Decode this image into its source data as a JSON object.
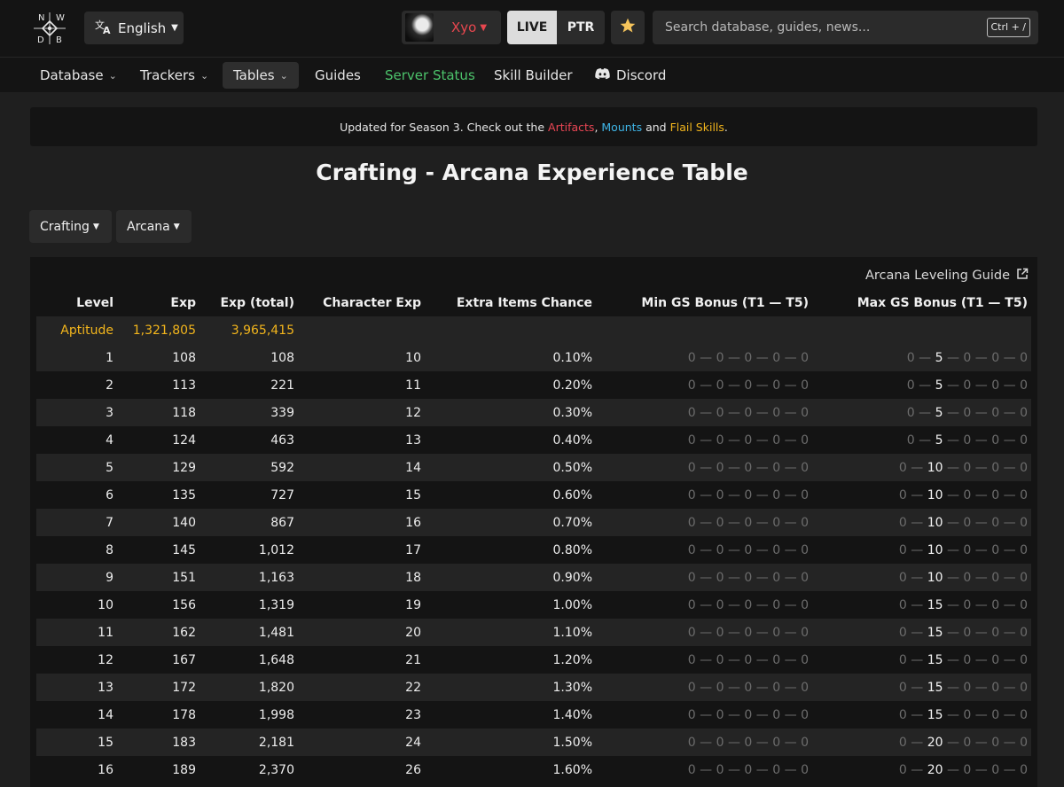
{
  "header": {
    "logo_letters": [
      "N",
      "W",
      "D",
      "B"
    ],
    "language": "English",
    "username": "Xyo",
    "env_live": "LIVE",
    "env_ptr": "PTR",
    "search_placeholder": "Search database, guides, news...",
    "search_shortcut": "Ctrl + /",
    "colors": {
      "accent_user": "#e8474f",
      "favorite_star": "#f5c45b"
    }
  },
  "nav": {
    "items": [
      {
        "label": "Database"
      },
      {
        "label": "Trackers"
      },
      {
        "label": "Tables"
      },
      {
        "label": "Guides"
      },
      {
        "label": "Server Status"
      },
      {
        "label": "Skill Builder"
      },
      {
        "label": "Discord"
      }
    ]
  },
  "banner": {
    "prefix": "Updated for Season 3. Check out the ",
    "link1": "Artifacts",
    "sep1": ", ",
    "link2": "Mounts",
    "sep2": " and ",
    "link3": "Flail Skills",
    "suffix": "."
  },
  "page": {
    "title": "Crafting - Arcana Experience Table",
    "filter_category": "Crafting",
    "filter_skill": "Arcana",
    "guide_link": "Arcana Leveling Guide"
  },
  "table": {
    "headers": [
      "Level",
      "Exp",
      "Exp (total)",
      "Character Exp",
      "Extra Items Chance",
      "Min GS Bonus (T1 — T5)",
      "Max GS Bonus (T1 — T5)"
    ],
    "aptitude": {
      "label": "Aptitude",
      "exp": "1,321,805",
      "exp_total": "3,965,415"
    },
    "rows": [
      {
        "level": "1",
        "exp": "108",
        "total": "108",
        "char_exp": "10",
        "chance": "0.10%",
        "min_gs": [
          "0",
          "0",
          "0",
          "0",
          "0"
        ],
        "max_gs": [
          "0",
          "5",
          "0",
          "0",
          "0"
        ]
      },
      {
        "level": "2",
        "exp": "113",
        "total": "221",
        "char_exp": "11",
        "chance": "0.20%",
        "min_gs": [
          "0",
          "0",
          "0",
          "0",
          "0"
        ],
        "max_gs": [
          "0",
          "5",
          "0",
          "0",
          "0"
        ]
      },
      {
        "level": "3",
        "exp": "118",
        "total": "339",
        "char_exp": "12",
        "chance": "0.30%",
        "min_gs": [
          "0",
          "0",
          "0",
          "0",
          "0"
        ],
        "max_gs": [
          "0",
          "5",
          "0",
          "0",
          "0"
        ]
      },
      {
        "level": "4",
        "exp": "124",
        "total": "463",
        "char_exp": "13",
        "chance": "0.40%",
        "min_gs": [
          "0",
          "0",
          "0",
          "0",
          "0"
        ],
        "max_gs": [
          "0",
          "5",
          "0",
          "0",
          "0"
        ]
      },
      {
        "level": "5",
        "exp": "129",
        "total": "592",
        "char_exp": "14",
        "chance": "0.50%",
        "min_gs": [
          "0",
          "0",
          "0",
          "0",
          "0"
        ],
        "max_gs": [
          "0",
          "10",
          "0",
          "0",
          "0"
        ]
      },
      {
        "level": "6",
        "exp": "135",
        "total": "727",
        "char_exp": "15",
        "chance": "0.60%",
        "min_gs": [
          "0",
          "0",
          "0",
          "0",
          "0"
        ],
        "max_gs": [
          "0",
          "10",
          "0",
          "0",
          "0"
        ]
      },
      {
        "level": "7",
        "exp": "140",
        "total": "867",
        "char_exp": "16",
        "chance": "0.70%",
        "min_gs": [
          "0",
          "0",
          "0",
          "0",
          "0"
        ],
        "max_gs": [
          "0",
          "10",
          "0",
          "0",
          "0"
        ]
      },
      {
        "level": "8",
        "exp": "145",
        "total": "1,012",
        "char_exp": "17",
        "chance": "0.80%",
        "min_gs": [
          "0",
          "0",
          "0",
          "0",
          "0"
        ],
        "max_gs": [
          "0",
          "10",
          "0",
          "0",
          "0"
        ]
      },
      {
        "level": "9",
        "exp": "151",
        "total": "1,163",
        "char_exp": "18",
        "chance": "0.90%",
        "min_gs": [
          "0",
          "0",
          "0",
          "0",
          "0"
        ],
        "max_gs": [
          "0",
          "10",
          "0",
          "0",
          "0"
        ]
      },
      {
        "level": "10",
        "exp": "156",
        "total": "1,319",
        "char_exp": "19",
        "chance": "1.00%",
        "min_gs": [
          "0",
          "0",
          "0",
          "0",
          "0"
        ],
        "max_gs": [
          "0",
          "15",
          "0",
          "0",
          "0"
        ]
      },
      {
        "level": "11",
        "exp": "162",
        "total": "1,481",
        "char_exp": "20",
        "chance": "1.10%",
        "min_gs": [
          "0",
          "0",
          "0",
          "0",
          "0"
        ],
        "max_gs": [
          "0",
          "15",
          "0",
          "0",
          "0"
        ]
      },
      {
        "level": "12",
        "exp": "167",
        "total": "1,648",
        "char_exp": "21",
        "chance": "1.20%",
        "min_gs": [
          "0",
          "0",
          "0",
          "0",
          "0"
        ],
        "max_gs": [
          "0",
          "15",
          "0",
          "0",
          "0"
        ]
      },
      {
        "level": "13",
        "exp": "172",
        "total": "1,820",
        "char_exp": "22",
        "chance": "1.30%",
        "min_gs": [
          "0",
          "0",
          "0",
          "0",
          "0"
        ],
        "max_gs": [
          "0",
          "15",
          "0",
          "0",
          "0"
        ]
      },
      {
        "level": "14",
        "exp": "178",
        "total": "1,998",
        "char_exp": "23",
        "chance": "1.40%",
        "min_gs": [
          "0",
          "0",
          "0",
          "0",
          "0"
        ],
        "max_gs": [
          "0",
          "15",
          "0",
          "0",
          "0"
        ]
      },
      {
        "level": "15",
        "exp": "183",
        "total": "2,181",
        "char_exp": "24",
        "chance": "1.50%",
        "min_gs": [
          "0",
          "0",
          "0",
          "0",
          "0"
        ],
        "max_gs": [
          "0",
          "20",
          "0",
          "0",
          "0"
        ]
      },
      {
        "level": "16",
        "exp": "189",
        "total": "2,370",
        "char_exp": "26",
        "chance": "1.60%",
        "min_gs": [
          "0",
          "0",
          "0",
          "0",
          "0"
        ],
        "max_gs": [
          "0",
          "20",
          "0",
          "0",
          "0"
        ]
      }
    ]
  }
}
